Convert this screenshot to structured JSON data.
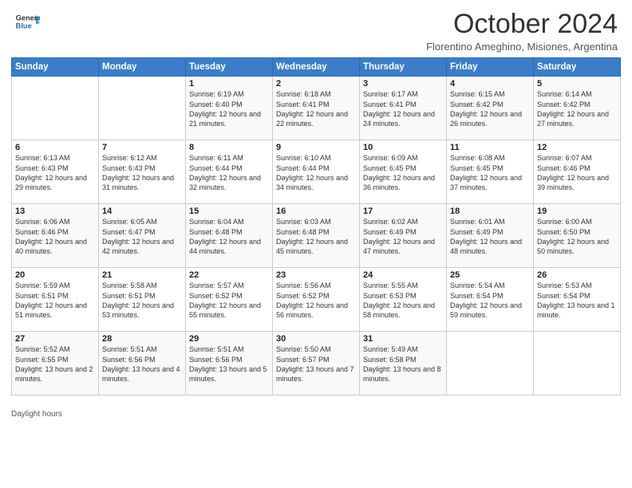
{
  "header": {
    "logo_line1": "General",
    "logo_line2": "Blue",
    "month_title": "October 2024",
    "subtitle": "Florentino Ameghino, Misiones, Argentina"
  },
  "days_of_week": [
    "Sunday",
    "Monday",
    "Tuesday",
    "Wednesday",
    "Thursday",
    "Friday",
    "Saturday"
  ],
  "weeks": [
    [
      {
        "day": "",
        "info": ""
      },
      {
        "day": "",
        "info": ""
      },
      {
        "day": "1",
        "info": "Sunrise: 6:19 AM\nSunset: 6:40 PM\nDaylight: 12 hours\nand 21 minutes."
      },
      {
        "day": "2",
        "info": "Sunrise: 6:18 AM\nSunset: 6:41 PM\nDaylight: 12 hours\nand 22 minutes."
      },
      {
        "day": "3",
        "info": "Sunrise: 6:17 AM\nSunset: 6:41 PM\nDaylight: 12 hours\nand 24 minutes."
      },
      {
        "day": "4",
        "info": "Sunrise: 6:15 AM\nSunset: 6:42 PM\nDaylight: 12 hours\nand 26 minutes."
      },
      {
        "day": "5",
        "info": "Sunrise: 6:14 AM\nSunset: 6:42 PM\nDaylight: 12 hours\nand 27 minutes."
      }
    ],
    [
      {
        "day": "6",
        "info": "Sunrise: 6:13 AM\nSunset: 6:43 PM\nDaylight: 12 hours\nand 29 minutes."
      },
      {
        "day": "7",
        "info": "Sunrise: 6:12 AM\nSunset: 6:43 PM\nDaylight: 12 hours\nand 31 minutes."
      },
      {
        "day": "8",
        "info": "Sunrise: 6:11 AM\nSunset: 6:44 PM\nDaylight: 12 hours\nand 32 minutes."
      },
      {
        "day": "9",
        "info": "Sunrise: 6:10 AM\nSunset: 6:44 PM\nDaylight: 12 hours\nand 34 minutes."
      },
      {
        "day": "10",
        "info": "Sunrise: 6:09 AM\nSunset: 6:45 PM\nDaylight: 12 hours\nand 36 minutes."
      },
      {
        "day": "11",
        "info": "Sunrise: 6:08 AM\nSunset: 6:45 PM\nDaylight: 12 hours\nand 37 minutes."
      },
      {
        "day": "12",
        "info": "Sunrise: 6:07 AM\nSunset: 6:46 PM\nDaylight: 12 hours\nand 39 minutes."
      }
    ],
    [
      {
        "day": "13",
        "info": "Sunrise: 6:06 AM\nSunset: 6:46 PM\nDaylight: 12 hours\nand 40 minutes."
      },
      {
        "day": "14",
        "info": "Sunrise: 6:05 AM\nSunset: 6:47 PM\nDaylight: 12 hours\nand 42 minutes."
      },
      {
        "day": "15",
        "info": "Sunrise: 6:04 AM\nSunset: 6:48 PM\nDaylight: 12 hours\nand 44 minutes."
      },
      {
        "day": "16",
        "info": "Sunrise: 6:03 AM\nSunset: 6:48 PM\nDaylight: 12 hours\nand 45 minutes."
      },
      {
        "day": "17",
        "info": "Sunrise: 6:02 AM\nSunset: 6:49 PM\nDaylight: 12 hours\nand 47 minutes."
      },
      {
        "day": "18",
        "info": "Sunrise: 6:01 AM\nSunset: 6:49 PM\nDaylight: 12 hours\nand 48 minutes."
      },
      {
        "day": "19",
        "info": "Sunrise: 6:00 AM\nSunset: 6:50 PM\nDaylight: 12 hours\nand 50 minutes."
      }
    ],
    [
      {
        "day": "20",
        "info": "Sunrise: 5:59 AM\nSunset: 6:51 PM\nDaylight: 12 hours\nand 51 minutes."
      },
      {
        "day": "21",
        "info": "Sunrise: 5:58 AM\nSunset: 6:51 PM\nDaylight: 12 hours\nand 53 minutes."
      },
      {
        "day": "22",
        "info": "Sunrise: 5:57 AM\nSunset: 6:52 PM\nDaylight: 12 hours\nand 55 minutes."
      },
      {
        "day": "23",
        "info": "Sunrise: 5:56 AM\nSunset: 6:52 PM\nDaylight: 12 hours\nand 56 minutes."
      },
      {
        "day": "24",
        "info": "Sunrise: 5:55 AM\nSunset: 6:53 PM\nDaylight: 12 hours\nand 58 minutes."
      },
      {
        "day": "25",
        "info": "Sunrise: 5:54 AM\nSunset: 6:54 PM\nDaylight: 12 hours\nand 59 minutes."
      },
      {
        "day": "26",
        "info": "Sunrise: 5:53 AM\nSunset: 6:54 PM\nDaylight: 13 hours\nand 1 minute."
      }
    ],
    [
      {
        "day": "27",
        "info": "Sunrise: 5:52 AM\nSunset: 6:55 PM\nDaylight: 13 hours\nand 2 minutes."
      },
      {
        "day": "28",
        "info": "Sunrise: 5:51 AM\nSunset: 6:56 PM\nDaylight: 13 hours\nand 4 minutes."
      },
      {
        "day": "29",
        "info": "Sunrise: 5:51 AM\nSunset: 6:56 PM\nDaylight: 13 hours\nand 5 minutes."
      },
      {
        "day": "30",
        "info": "Sunrise: 5:50 AM\nSunset: 6:57 PM\nDaylight: 13 hours\nand 7 minutes."
      },
      {
        "day": "31",
        "info": "Sunrise: 5:49 AM\nSunset: 6:58 PM\nDaylight: 13 hours\nand 8 minutes."
      },
      {
        "day": "",
        "info": ""
      },
      {
        "day": "",
        "info": ""
      }
    ]
  ],
  "footer": {
    "daylight_label": "Daylight hours"
  }
}
